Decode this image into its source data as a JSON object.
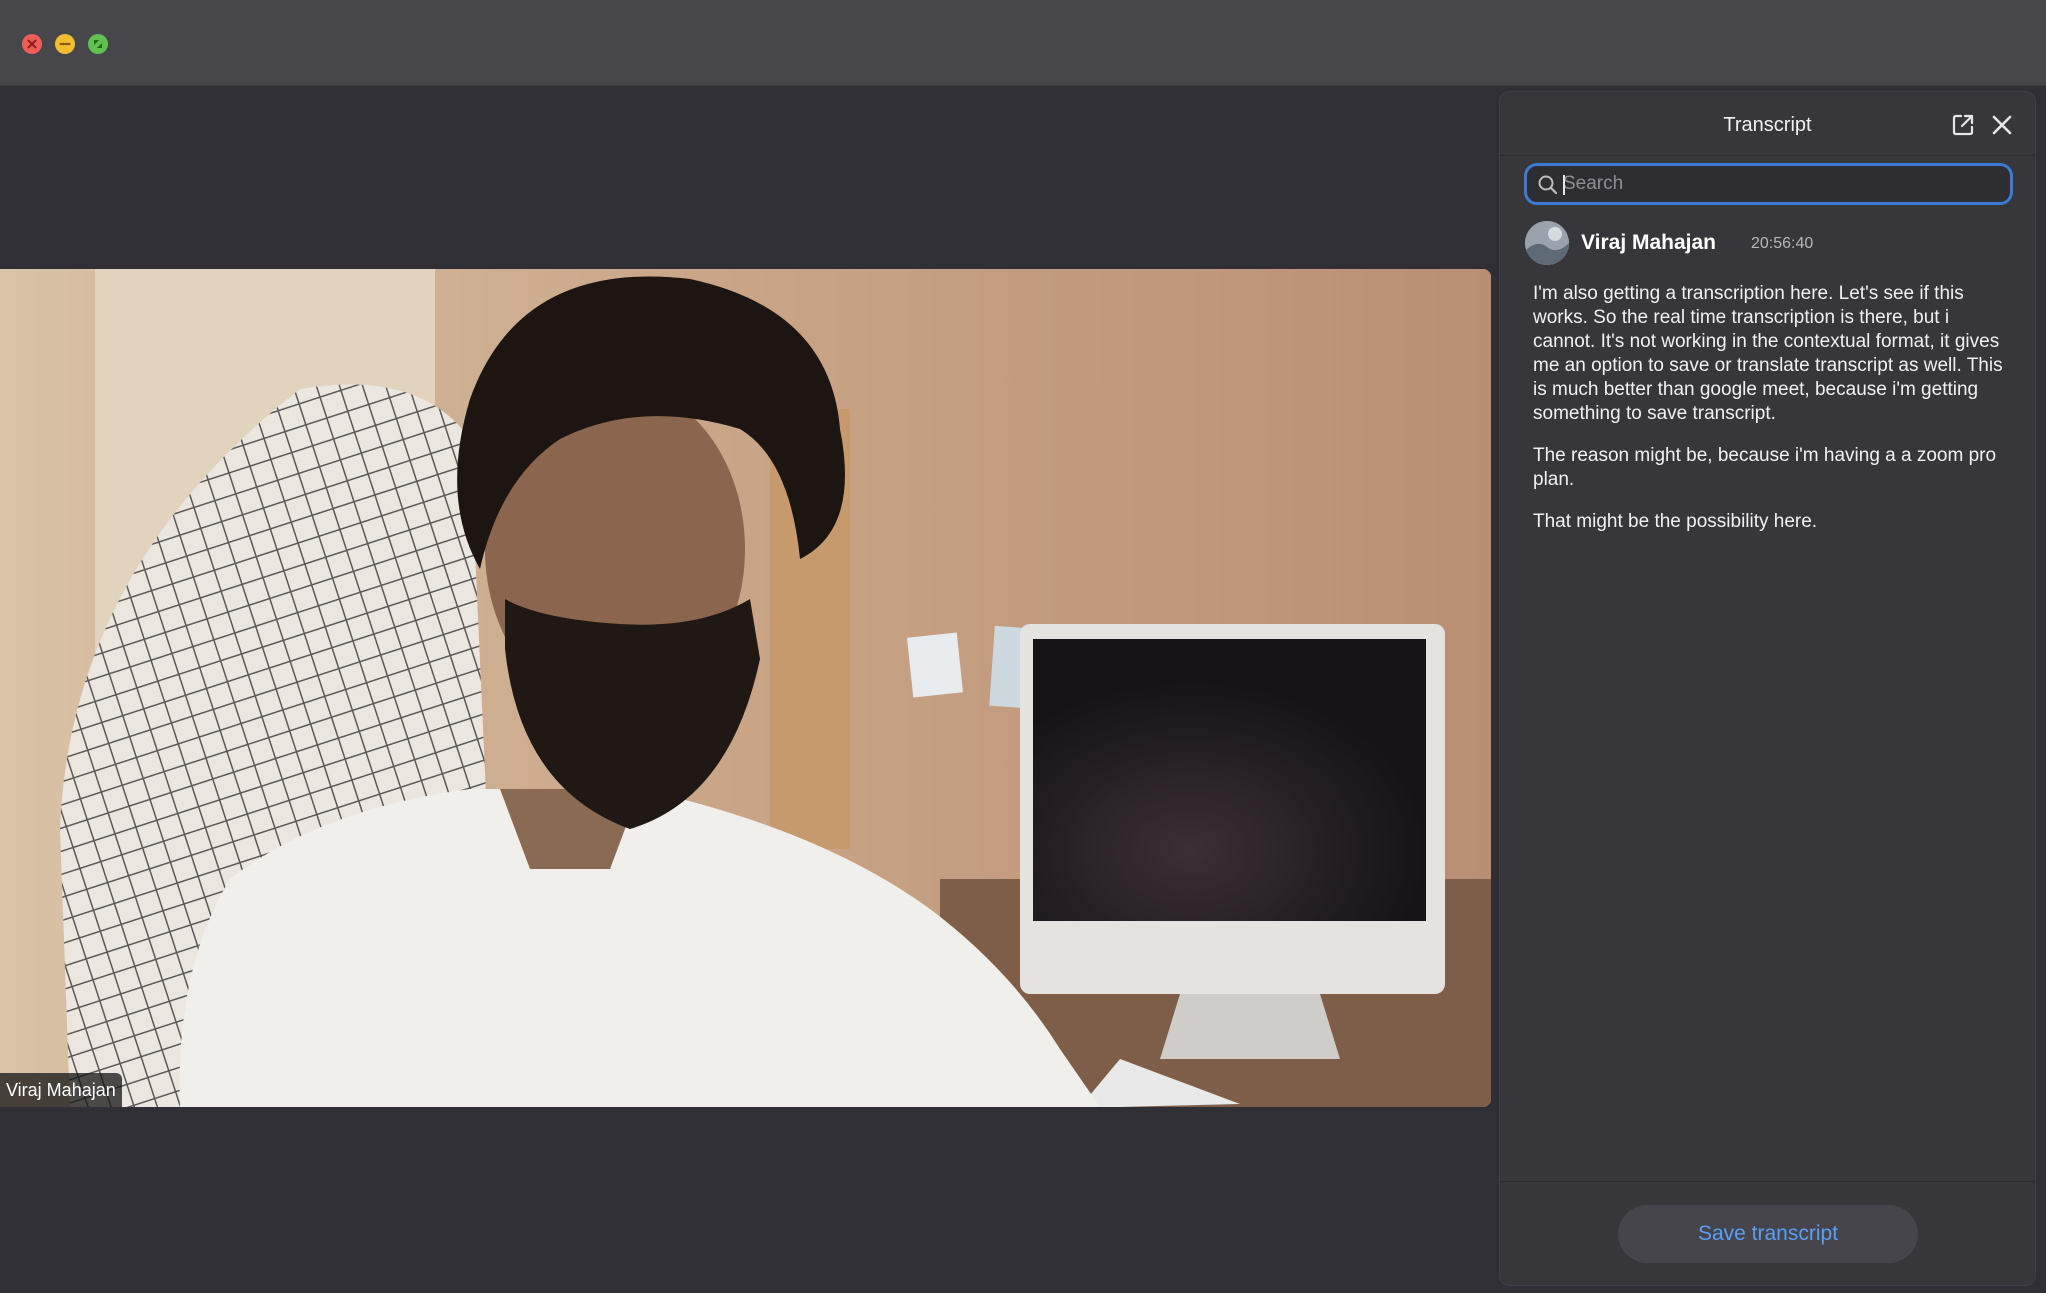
{
  "window": {
    "controls": [
      "close-icon",
      "minimize-icon",
      "maximize-icon"
    ]
  },
  "video": {
    "participant_name": "Viraj Mahajan"
  },
  "transcript_panel": {
    "title": "Transcript",
    "search_placeholder": "Search",
    "search_value": "",
    "entries": [
      {
        "speaker": "Viraj Mahajan",
        "time": "20:56:40",
        "paragraphs": [
          "I'm also getting a transcription here. Let's see if this works. So the real time transcription is there, but i cannot. It's not working in the contextual format, it gives me an option to save or translate transcript as well. This is much better than google meet, because i'm getting something to save transcript.",
          "The reason might be, because i'm having a a zoom pro plan.",
          "That might be the possibility here."
        ]
      }
    ],
    "save_button_label": "Save transcript"
  },
  "colors": {
    "accent": "#3b7bd4",
    "link": "#5a9ef5",
    "panel_bg": "#36363b",
    "app_bg": "#2f2f35"
  }
}
